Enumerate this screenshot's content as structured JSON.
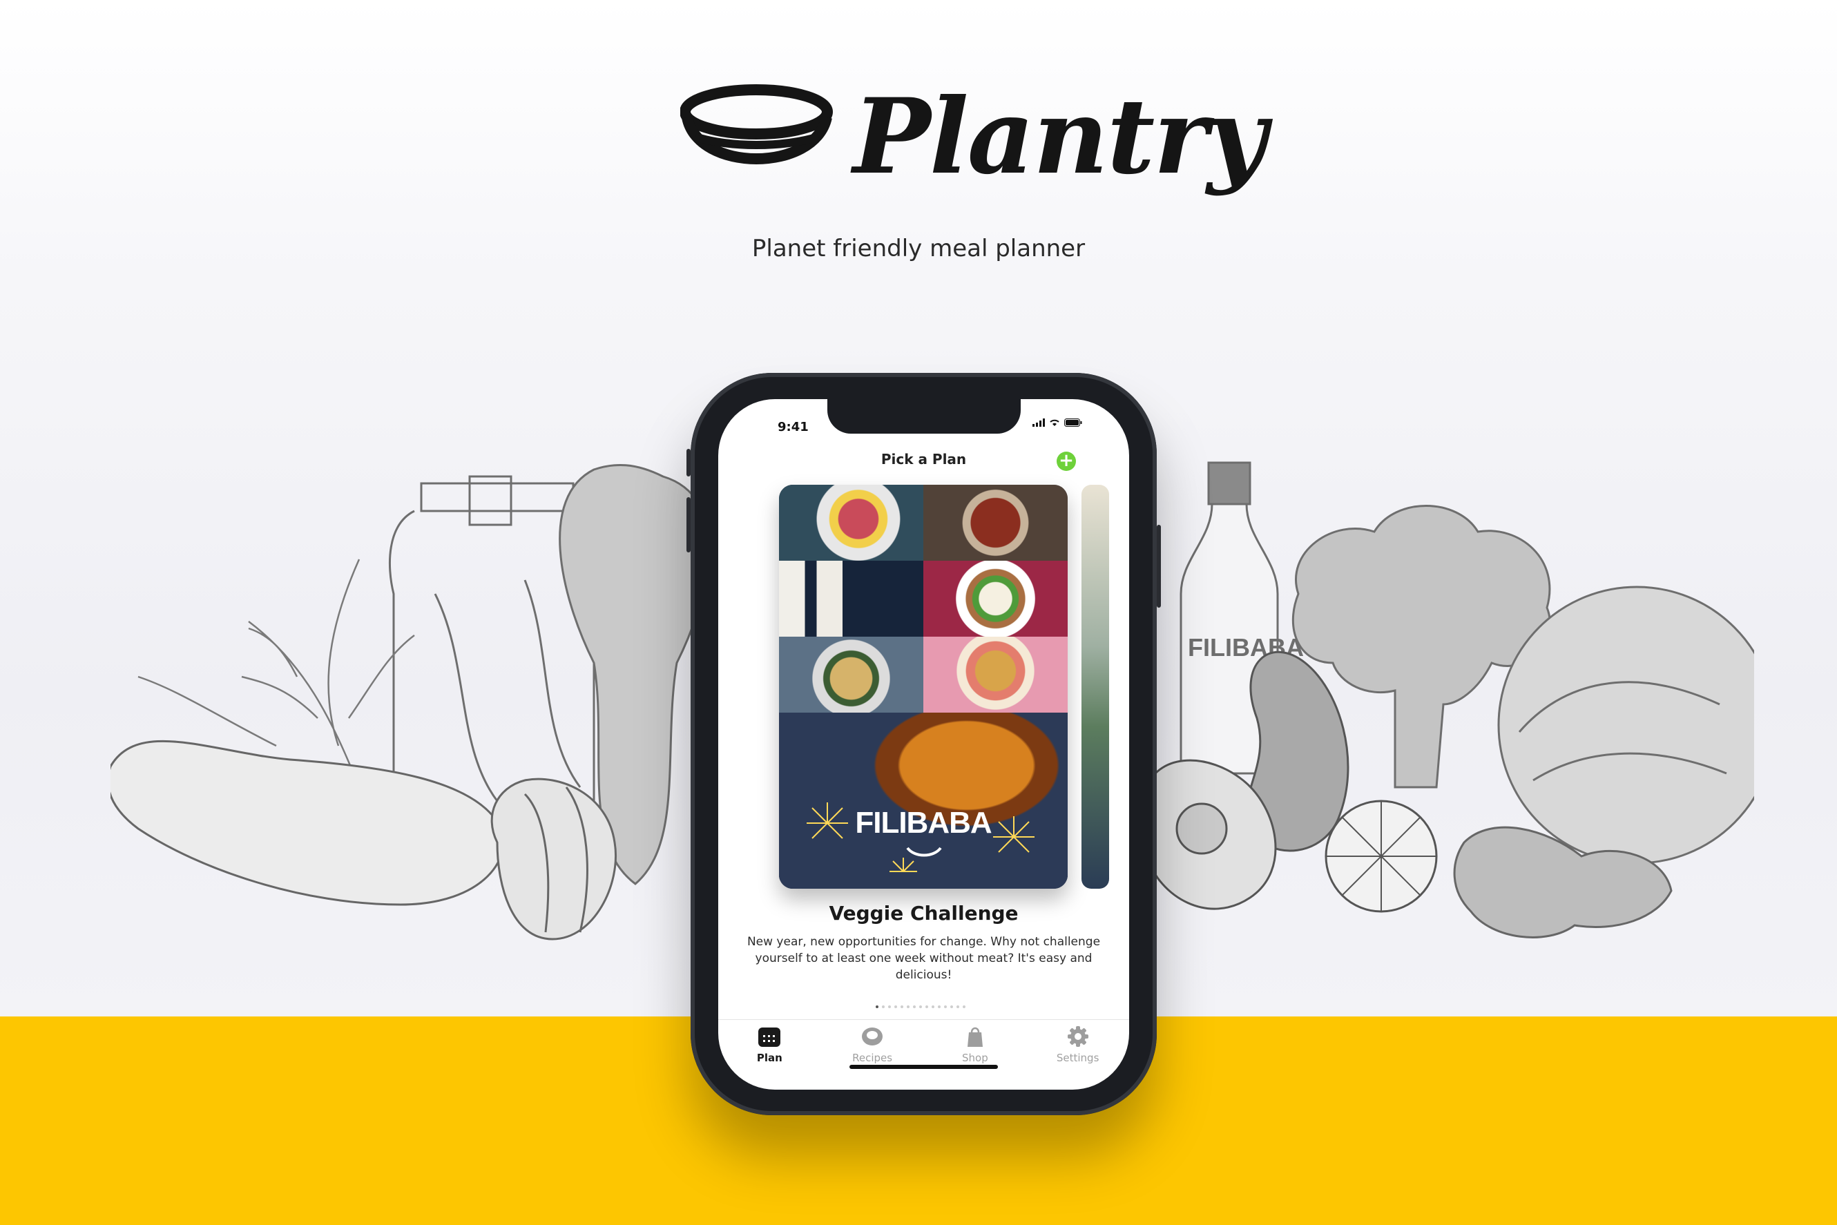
{
  "brand": {
    "name": "Plantry",
    "tagline": "Planet friendly meal planner"
  },
  "phone": {
    "status": {
      "time": "9:41"
    },
    "nav": {
      "title": "Pick a Plan",
      "add_icon": "plus-circle-icon"
    },
    "plan": {
      "title": "Veggie Challenge",
      "description": "New year, new opportunities for change. Why not challenge yourself to at least one week without meat? It's easy and delicious!",
      "brand_overlay": "FILIBABA",
      "page_count": 15,
      "current_page": 1
    },
    "tabs": [
      {
        "label": "Plan",
        "icon": "calendar-icon",
        "active": true
      },
      {
        "label": "Recipes",
        "icon": "chef-hat-icon",
        "active": false
      },
      {
        "label": "Shop",
        "icon": "shopping-bag-icon",
        "active": false
      },
      {
        "label": "Settings",
        "icon": "gear-icon",
        "active": false
      }
    ]
  },
  "illustration": {
    "bottle_label": "FILIBABA"
  },
  "colors": {
    "accent_yellow": "#fdc601",
    "add_green": "#6ed13a",
    "phone_body": "#1b1d22"
  }
}
